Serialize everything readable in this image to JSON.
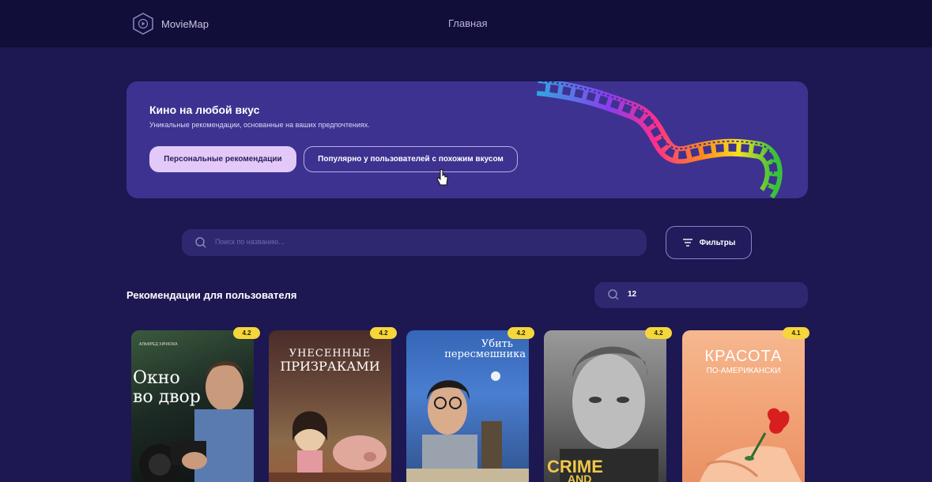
{
  "header": {
    "app_name": "MovieMap",
    "nav_home": "Главная"
  },
  "hero": {
    "title": "Кино на любой вкус",
    "subtitle": "Уникальные рекомендации, основанные на ваших предпочтениях.",
    "btn_personal": "Персональные рекомендации",
    "btn_popular": "Популярно у пользователей с похожим вкусом"
  },
  "search": {
    "placeholder": "Поиск по названию...",
    "filters_label": "Фильтры"
  },
  "recommendations": {
    "title": "Рекомендации для пользователя",
    "count_value": "12",
    "movies": [
      {
        "title_line1": "Окно",
        "title_line2": "во двор",
        "rating": "4.2",
        "poster_small": "АЛЬФРЕД ХИЧКОКА"
      },
      {
        "title_line1": "УНЕСЕННЫЕ",
        "title_line2": "ПРИЗРАКАМИ",
        "rating": "4.2"
      },
      {
        "title_line1": "Убить",
        "title_line2": "пересмешника",
        "rating": "4.2"
      },
      {
        "title_line1": "CRIME",
        "title_line2": "AND PUNISHMENT",
        "rating": "4.2"
      },
      {
        "title_line1": "КРАСОТА",
        "title_line2": "ПО-АМЕРИКАНСКИ",
        "rating": "4.1"
      }
    ]
  },
  "colors": {
    "background": "#1d1752",
    "header": "#120e3a",
    "hero_panel": "#3d3290",
    "primary_button": "#e3c9f7",
    "rating_badge": "#f5d63b"
  }
}
